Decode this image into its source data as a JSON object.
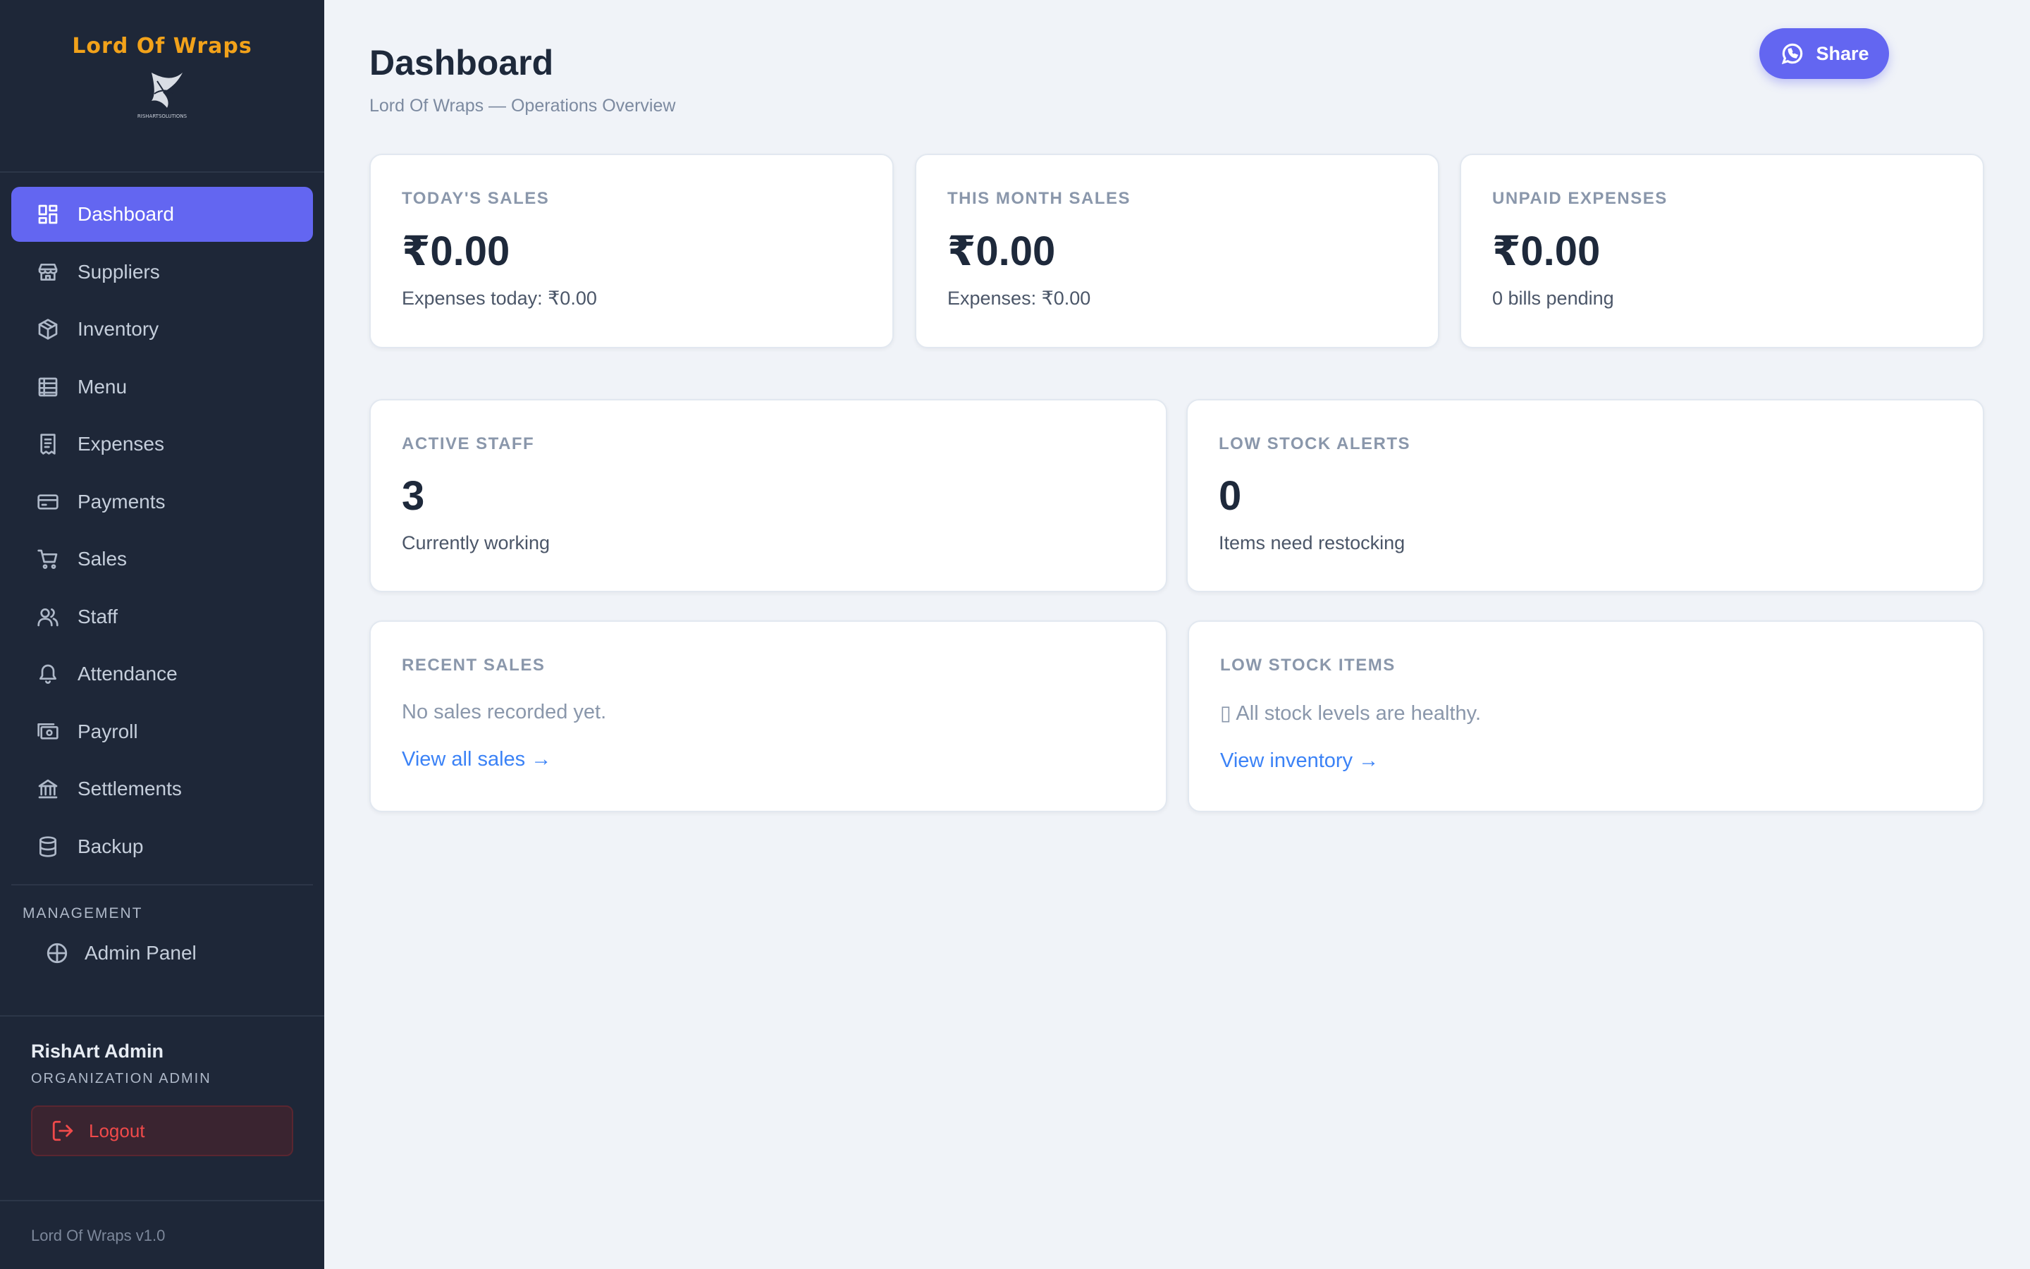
{
  "brand": {
    "title": "Lord Of Wraps",
    "logo_caption": "RISHARTSOLUTIONS"
  },
  "sidebar": {
    "items": [
      {
        "label": "Dashboard",
        "icon": "dashboard-icon"
      },
      {
        "label": "Suppliers",
        "icon": "store-icon"
      },
      {
        "label": "Inventory",
        "icon": "box-icon"
      },
      {
        "label": "Menu",
        "icon": "list-icon"
      },
      {
        "label": "Expenses",
        "icon": "receipt-icon"
      },
      {
        "label": "Payments",
        "icon": "credit-card-icon"
      },
      {
        "label": "Sales",
        "icon": "cart-icon"
      },
      {
        "label": "Staff",
        "icon": "users-icon"
      },
      {
        "label": "Attendance",
        "icon": "bell-icon"
      },
      {
        "label": "Payroll",
        "icon": "banknote-icon"
      },
      {
        "label": "Settlements",
        "icon": "bank-icon"
      },
      {
        "label": "Backup",
        "icon": "database-icon"
      }
    ],
    "active_index": 0,
    "management_label": "MANAGEMENT",
    "admin_panel_label": "Admin Panel"
  },
  "user": {
    "name": "RishArt Admin",
    "role": "ORGANIZATION ADMIN",
    "logout_label": "Logout"
  },
  "version": "Lord Of Wraps v1.0",
  "header": {
    "title": "Dashboard",
    "subtitle": "Lord Of Wraps — Operations Overview",
    "share_label": "Share"
  },
  "stats": {
    "today_sales": {
      "label": "TODAY'S SALES",
      "value": "₹0.00",
      "sub": "Expenses today: ₹0.00"
    },
    "month_sales": {
      "label": "THIS MONTH SALES",
      "value": "₹0.00",
      "sub": "Expenses: ₹0.00"
    },
    "unpaid_expenses": {
      "label": "UNPAID EXPENSES",
      "value": "₹0.00",
      "sub": "0 bills pending"
    },
    "active_staff": {
      "label": "ACTIVE STAFF",
      "value": "3",
      "sub": "Currently working"
    },
    "low_stock_alerts": {
      "label": "LOW STOCK ALERTS",
      "value": "0",
      "sub": "Items need restocking"
    }
  },
  "recent_sales": {
    "label": "RECENT SALES",
    "empty": "No sales recorded yet.",
    "link": "View all sales →"
  },
  "low_stock_items": {
    "label": "LOW STOCK ITEMS",
    "empty": "▯ All stock levels are healthy.",
    "link": "View inventory →"
  },
  "colors": {
    "accent": "#6366f1",
    "sidebar_bg": "#1e2738",
    "brand": "#f2a21a",
    "link": "#3b82f6",
    "danger": "#f04a4a"
  }
}
